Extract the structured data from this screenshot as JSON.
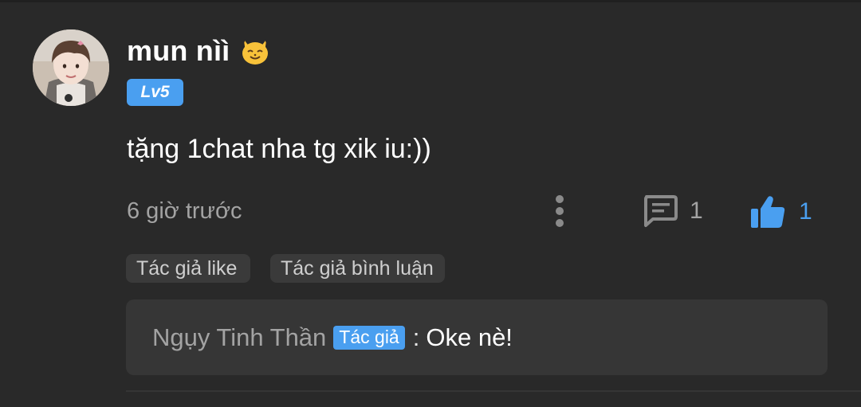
{
  "comment": {
    "username": "mun nìì",
    "level": "Lv5",
    "text": "tặng 1chat nha tg xik iu:))",
    "time": "6 giờ trước",
    "reply_count": "1",
    "like_count": "1",
    "icons": {
      "avatar": "user-avatar",
      "emoji": "cat-face-emoji",
      "more": "more-vertical-icon",
      "reply": "comment-bubble-icon",
      "like": "thumbs-up-icon"
    }
  },
  "tags": [
    {
      "label": "Tác giả like"
    },
    {
      "label": "Tác giả bình luận"
    }
  ],
  "reply": {
    "author": "Ngụy Tinh Thần",
    "badge": "Tác giả",
    "separator": ":",
    "text": "Oke nè!"
  },
  "colors": {
    "background": "#292929",
    "accent": "#4a9ff0",
    "muted_text": "#a3a3a3",
    "tag_bg": "#3a3a3a",
    "reply_bg": "#363636"
  }
}
